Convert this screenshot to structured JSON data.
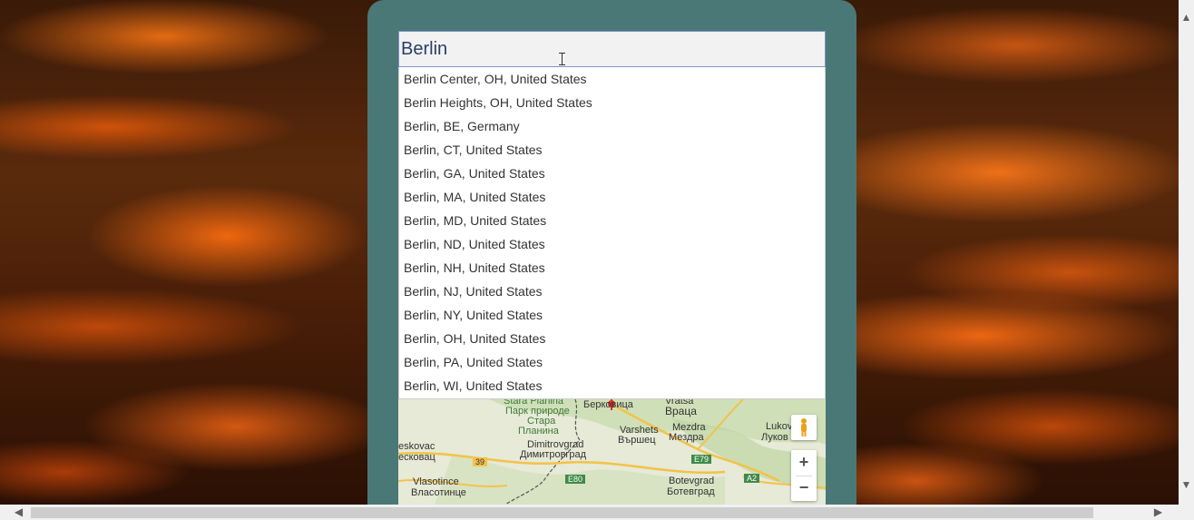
{
  "search": {
    "value": "Berlin"
  },
  "suggestions": [
    "Berlin Center, OH, United States",
    "Berlin Heights, OH, United States",
    "Berlin, BE, Germany",
    "Berlin, CT, United States",
    "Berlin, GA, United States",
    "Berlin, MA, United States",
    "Berlin, MD, United States",
    "Berlin, ND, United States",
    "Berlin, NH, United States",
    "Berlin, NJ, United States",
    "Berlin, NY, United States",
    "Berlin, OH, United States",
    "Berlin, PA, United States",
    "Berlin, WI, United States"
  ],
  "map": {
    "labels": {
      "stara_planina": "Stara Planina",
      "park_prirode": "Парк природе",
      "stara": "Стара",
      "planina": "Планина",
      "berkovica": "Берковица",
      "vratsa": "Vratsa",
      "vraca": "Враца",
      "lukov": "Lukov",
      "lukov_cyr": "Луков",
      "eskovac": "eskovac",
      "eskovac_cyr": "есковац",
      "dimitrovgrad": "Dimitrovgrad",
      "dimitrovgrad_cyr": "Димитровград",
      "varshets": "Varshets",
      "varshets_cyr": "Вършец",
      "mezdra": "Mezdra",
      "mezdra_cyr": "Мездра",
      "vlasotince": "Vlasotince",
      "vlasotince_cyr": "Власотинце",
      "botevgrad": "Botevgrad",
      "botevgrad_cyr": "Ботевград",
      "road_39": "39",
      "road_e80": "E80",
      "road_e79": "E79",
      "road_a2": "A2"
    },
    "zoom_in": "+",
    "zoom_out": "−"
  },
  "scrollbar": {
    "up": "▲",
    "down": "▼",
    "left": "◀",
    "right": "▶"
  },
  "colors": {
    "panel": "#4a7876",
    "search_border": "#7f93c6",
    "marker": "#d93025"
  }
}
